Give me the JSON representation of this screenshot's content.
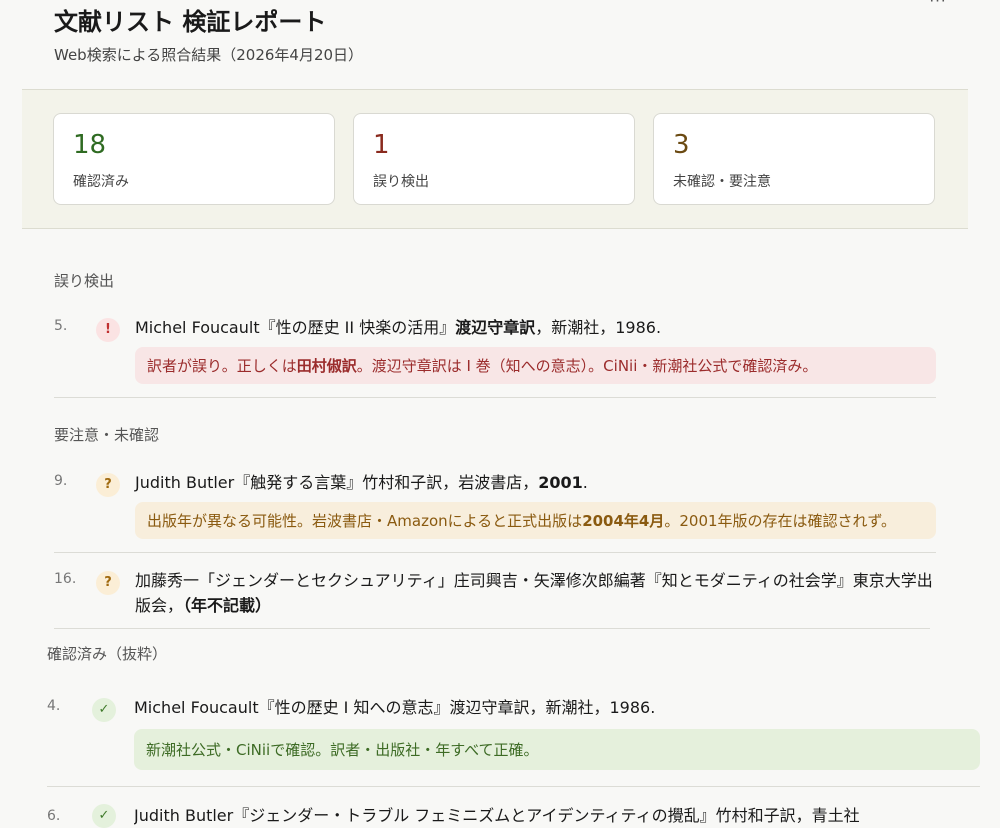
{
  "header": {
    "title": "文献リスト 検証レポート",
    "subtitle": "Web検索による照合結果（2026年4月20日）",
    "more_icon": "more-horizontal-icon",
    "more_label": "···"
  },
  "summary": [
    {
      "value": "18",
      "label": "確認済み",
      "color": "#2f6b22"
    },
    {
      "value": "1",
      "label": "誤り検出",
      "color": "#8a2a1e"
    },
    {
      "value": "3",
      "label": "未確認・要注意",
      "color": "#6b4a12"
    }
  ],
  "sections": {
    "errors": "誤り検出",
    "warnings": "要注意・未確認",
    "confirmed": "確認済み（抜粋）"
  },
  "entries": {
    "e5": {
      "num": "5.",
      "badge": "!",
      "ref_a": "Michel Foucault『性の歴史 II 快楽の活用』",
      "ref_b": "渡辺守章訳",
      "ref_c": "，新潮社，1986.",
      "note_a": "訳者が誤り。正しくは ",
      "note_b": "田村俶訳",
      "note_c": "。渡辺守章訳は I 巻（知への意志）。CiNii・新潮社公式で確認済み。"
    },
    "e9": {
      "num": "9.",
      "badge": "?",
      "ref_a": "Judith Butler『触発する言葉』竹村和子訳，岩波書店，",
      "ref_b": "2001",
      "ref_c": ".",
      "note_a": "出版年が異なる可能性。岩波書店・Amazonによると正式出版は ",
      "note_b": "2004年4月",
      "note_c": "。2001年版の存在は確認されず。"
    },
    "e16": {
      "num": "16.",
      "badge": "?",
      "ref_a": "加藤秀一「ジェンダーとセクシュアリティ」庄司興吉・矢澤修次郎編著『知とモダニティの社会学』東京大学出版会，",
      "ref_b": "（年不記載）"
    },
    "e4": {
      "num": "4.",
      "badge": "✓",
      "ref": "Michel Foucault『性の歴史 I 知への意志』渡辺守章訳，新潮社，1986.",
      "note": "新潮社公式・CiNiiで確認。訳者・出版社・年すべて正確。"
    },
    "e6": {
      "num": "6.",
      "badge": "✓",
      "ref": "Judith Butler『ジェンダー・トラブル フェミニズムとアイデンティティの攪乱』竹村和子訳，青土社"
    }
  }
}
